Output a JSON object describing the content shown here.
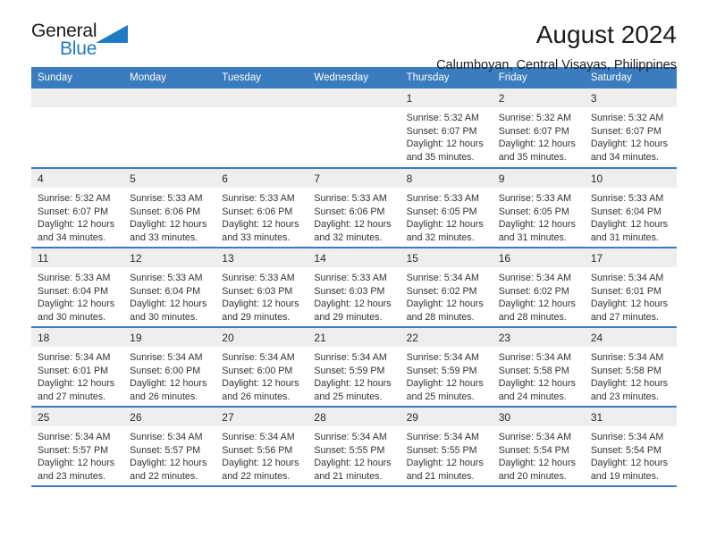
{
  "brand": {
    "name_part1": "General",
    "name_part2": "Blue",
    "logo_icon": "triangle-icon",
    "accent_color": "#1f7ac4"
  },
  "header": {
    "title": "August 2024",
    "subtitle": "Calumboyan, Central Visayas, Philippines"
  },
  "theme": {
    "header_blue": "#3a7cbe",
    "band_gray": "#eeeeee"
  },
  "weekdays": [
    "Sunday",
    "Monday",
    "Tuesday",
    "Wednesday",
    "Thursday",
    "Friday",
    "Saturday"
  ],
  "weeks": [
    [
      {
        "day": "",
        "sunrise": "",
        "sunset": "",
        "daylight1": "",
        "daylight2": ""
      },
      {
        "day": "",
        "sunrise": "",
        "sunset": "",
        "daylight1": "",
        "daylight2": ""
      },
      {
        "day": "",
        "sunrise": "",
        "sunset": "",
        "daylight1": "",
        "daylight2": ""
      },
      {
        "day": "",
        "sunrise": "",
        "sunset": "",
        "daylight1": "",
        "daylight2": ""
      },
      {
        "day": "1",
        "sunrise": "Sunrise: 5:32 AM",
        "sunset": "Sunset: 6:07 PM",
        "daylight1": "Daylight: 12 hours",
        "daylight2": "and 35 minutes."
      },
      {
        "day": "2",
        "sunrise": "Sunrise: 5:32 AM",
        "sunset": "Sunset: 6:07 PM",
        "daylight1": "Daylight: 12 hours",
        "daylight2": "and 35 minutes."
      },
      {
        "day": "3",
        "sunrise": "Sunrise: 5:32 AM",
        "sunset": "Sunset: 6:07 PM",
        "daylight1": "Daylight: 12 hours",
        "daylight2": "and 34 minutes."
      }
    ],
    [
      {
        "day": "4",
        "sunrise": "Sunrise: 5:32 AM",
        "sunset": "Sunset: 6:07 PM",
        "daylight1": "Daylight: 12 hours",
        "daylight2": "and 34 minutes."
      },
      {
        "day": "5",
        "sunrise": "Sunrise: 5:33 AM",
        "sunset": "Sunset: 6:06 PM",
        "daylight1": "Daylight: 12 hours",
        "daylight2": "and 33 minutes."
      },
      {
        "day": "6",
        "sunrise": "Sunrise: 5:33 AM",
        "sunset": "Sunset: 6:06 PM",
        "daylight1": "Daylight: 12 hours",
        "daylight2": "and 33 minutes."
      },
      {
        "day": "7",
        "sunrise": "Sunrise: 5:33 AM",
        "sunset": "Sunset: 6:06 PM",
        "daylight1": "Daylight: 12 hours",
        "daylight2": "and 32 minutes."
      },
      {
        "day": "8",
        "sunrise": "Sunrise: 5:33 AM",
        "sunset": "Sunset: 6:05 PM",
        "daylight1": "Daylight: 12 hours",
        "daylight2": "and 32 minutes."
      },
      {
        "day": "9",
        "sunrise": "Sunrise: 5:33 AM",
        "sunset": "Sunset: 6:05 PM",
        "daylight1": "Daylight: 12 hours",
        "daylight2": "and 31 minutes."
      },
      {
        "day": "10",
        "sunrise": "Sunrise: 5:33 AM",
        "sunset": "Sunset: 6:04 PM",
        "daylight1": "Daylight: 12 hours",
        "daylight2": "and 31 minutes."
      }
    ],
    [
      {
        "day": "11",
        "sunrise": "Sunrise: 5:33 AM",
        "sunset": "Sunset: 6:04 PM",
        "daylight1": "Daylight: 12 hours",
        "daylight2": "and 30 minutes."
      },
      {
        "day": "12",
        "sunrise": "Sunrise: 5:33 AM",
        "sunset": "Sunset: 6:04 PM",
        "daylight1": "Daylight: 12 hours",
        "daylight2": "and 30 minutes."
      },
      {
        "day": "13",
        "sunrise": "Sunrise: 5:33 AM",
        "sunset": "Sunset: 6:03 PM",
        "daylight1": "Daylight: 12 hours",
        "daylight2": "and 29 minutes."
      },
      {
        "day": "14",
        "sunrise": "Sunrise: 5:33 AM",
        "sunset": "Sunset: 6:03 PM",
        "daylight1": "Daylight: 12 hours",
        "daylight2": "and 29 minutes."
      },
      {
        "day": "15",
        "sunrise": "Sunrise: 5:34 AM",
        "sunset": "Sunset: 6:02 PM",
        "daylight1": "Daylight: 12 hours",
        "daylight2": "and 28 minutes."
      },
      {
        "day": "16",
        "sunrise": "Sunrise: 5:34 AM",
        "sunset": "Sunset: 6:02 PM",
        "daylight1": "Daylight: 12 hours",
        "daylight2": "and 28 minutes."
      },
      {
        "day": "17",
        "sunrise": "Sunrise: 5:34 AM",
        "sunset": "Sunset: 6:01 PM",
        "daylight1": "Daylight: 12 hours",
        "daylight2": "and 27 minutes."
      }
    ],
    [
      {
        "day": "18",
        "sunrise": "Sunrise: 5:34 AM",
        "sunset": "Sunset: 6:01 PM",
        "daylight1": "Daylight: 12 hours",
        "daylight2": "and 27 minutes."
      },
      {
        "day": "19",
        "sunrise": "Sunrise: 5:34 AM",
        "sunset": "Sunset: 6:00 PM",
        "daylight1": "Daylight: 12 hours",
        "daylight2": "and 26 minutes."
      },
      {
        "day": "20",
        "sunrise": "Sunrise: 5:34 AM",
        "sunset": "Sunset: 6:00 PM",
        "daylight1": "Daylight: 12 hours",
        "daylight2": "and 26 minutes."
      },
      {
        "day": "21",
        "sunrise": "Sunrise: 5:34 AM",
        "sunset": "Sunset: 5:59 PM",
        "daylight1": "Daylight: 12 hours",
        "daylight2": "and 25 minutes."
      },
      {
        "day": "22",
        "sunrise": "Sunrise: 5:34 AM",
        "sunset": "Sunset: 5:59 PM",
        "daylight1": "Daylight: 12 hours",
        "daylight2": "and 25 minutes."
      },
      {
        "day": "23",
        "sunrise": "Sunrise: 5:34 AM",
        "sunset": "Sunset: 5:58 PM",
        "daylight1": "Daylight: 12 hours",
        "daylight2": "and 24 minutes."
      },
      {
        "day": "24",
        "sunrise": "Sunrise: 5:34 AM",
        "sunset": "Sunset: 5:58 PM",
        "daylight1": "Daylight: 12 hours",
        "daylight2": "and 23 minutes."
      }
    ],
    [
      {
        "day": "25",
        "sunrise": "Sunrise: 5:34 AM",
        "sunset": "Sunset: 5:57 PM",
        "daylight1": "Daylight: 12 hours",
        "daylight2": "and 23 minutes."
      },
      {
        "day": "26",
        "sunrise": "Sunrise: 5:34 AM",
        "sunset": "Sunset: 5:57 PM",
        "daylight1": "Daylight: 12 hours",
        "daylight2": "and 22 minutes."
      },
      {
        "day": "27",
        "sunrise": "Sunrise: 5:34 AM",
        "sunset": "Sunset: 5:56 PM",
        "daylight1": "Daylight: 12 hours",
        "daylight2": "and 22 minutes."
      },
      {
        "day": "28",
        "sunrise": "Sunrise: 5:34 AM",
        "sunset": "Sunset: 5:55 PM",
        "daylight1": "Daylight: 12 hours",
        "daylight2": "and 21 minutes."
      },
      {
        "day": "29",
        "sunrise": "Sunrise: 5:34 AM",
        "sunset": "Sunset: 5:55 PM",
        "daylight1": "Daylight: 12 hours",
        "daylight2": "and 21 minutes."
      },
      {
        "day": "30",
        "sunrise": "Sunrise: 5:34 AM",
        "sunset": "Sunset: 5:54 PM",
        "daylight1": "Daylight: 12 hours",
        "daylight2": "and 20 minutes."
      },
      {
        "day": "31",
        "sunrise": "Sunrise: 5:34 AM",
        "sunset": "Sunset: 5:54 PM",
        "daylight1": "Daylight: 12 hours",
        "daylight2": "and 19 minutes."
      }
    ]
  ]
}
